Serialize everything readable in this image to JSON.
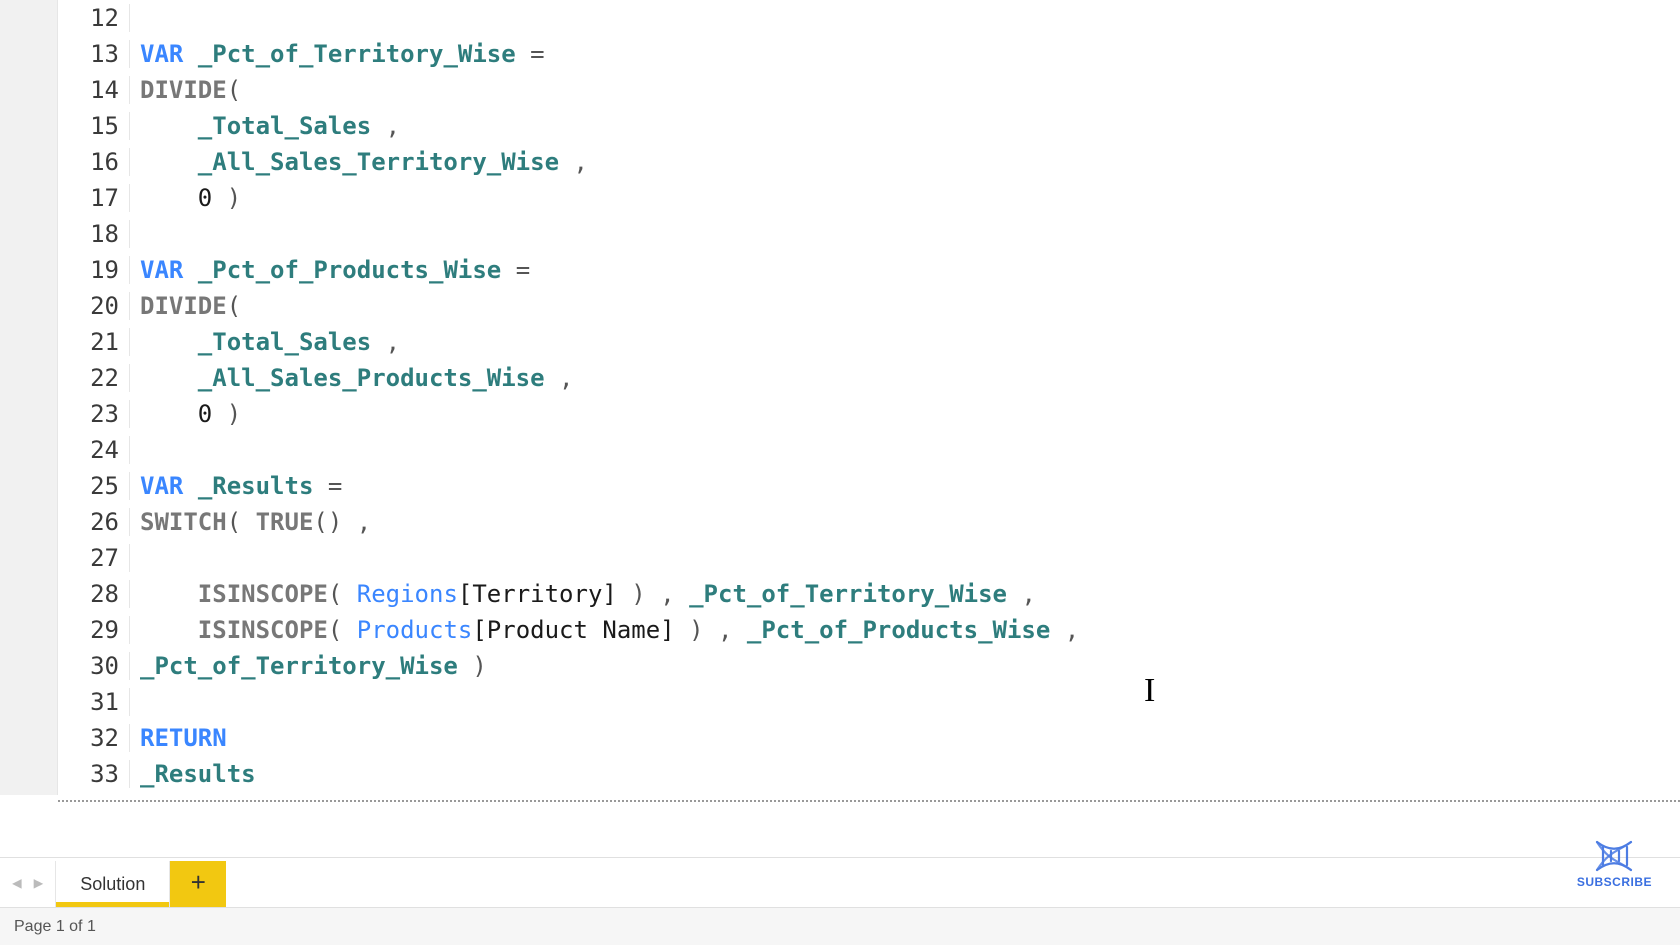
{
  "editor": {
    "lines": [
      {
        "num": 12,
        "tokens": []
      },
      {
        "num": 13,
        "tokens": [
          {
            "c": "t-kw",
            "t": "VAR"
          },
          {
            "t": " "
          },
          {
            "c": "t-var",
            "t": "_Pct_of_Territory_Wise"
          },
          {
            "t": " "
          },
          {
            "c": "t-punc",
            "t": "="
          }
        ]
      },
      {
        "num": 14,
        "tokens": [
          {
            "c": "t-fn",
            "t": "DIVIDE"
          },
          {
            "c": "t-punc",
            "t": "("
          }
        ]
      },
      {
        "num": 15,
        "tokens": [
          {
            "t": "    "
          },
          {
            "c": "t-var",
            "t": "_Total_Sales"
          },
          {
            "t": " "
          },
          {
            "c": "t-punc",
            "t": ","
          }
        ]
      },
      {
        "num": 16,
        "tokens": [
          {
            "t": "    "
          },
          {
            "c": "t-var",
            "t": "_All_Sales_Territory_Wise"
          },
          {
            "t": " "
          },
          {
            "c": "t-punc",
            "t": ","
          }
        ]
      },
      {
        "num": 17,
        "tokens": [
          {
            "t": "    "
          },
          {
            "c": "t-num",
            "t": "0"
          },
          {
            "t": " "
          },
          {
            "c": "t-punc",
            "t": ")"
          }
        ]
      },
      {
        "num": 18,
        "tokens": []
      },
      {
        "num": 19,
        "tokens": [
          {
            "c": "t-kw",
            "t": "VAR"
          },
          {
            "t": " "
          },
          {
            "c": "t-var",
            "t": "_Pct_of_Products_Wise"
          },
          {
            "t": " "
          },
          {
            "c": "t-punc",
            "t": "="
          }
        ]
      },
      {
        "num": 20,
        "tokens": [
          {
            "c": "t-fn",
            "t": "DIVIDE"
          },
          {
            "c": "t-punc",
            "t": "("
          }
        ]
      },
      {
        "num": 21,
        "tokens": [
          {
            "t": "    "
          },
          {
            "c": "t-var",
            "t": "_Total_Sales"
          },
          {
            "t": " "
          },
          {
            "c": "t-punc",
            "t": ","
          }
        ]
      },
      {
        "num": 22,
        "tokens": [
          {
            "t": "    "
          },
          {
            "c": "t-var",
            "t": "_All_Sales_Products_Wise"
          },
          {
            "t": " "
          },
          {
            "c": "t-punc",
            "t": ","
          }
        ]
      },
      {
        "num": 23,
        "tokens": [
          {
            "t": "    "
          },
          {
            "c": "t-num",
            "t": "0"
          },
          {
            "t": " "
          },
          {
            "c": "t-punc",
            "t": ")"
          }
        ]
      },
      {
        "num": 24,
        "tokens": []
      },
      {
        "num": 25,
        "tokens": [
          {
            "c": "t-kw",
            "t": "VAR"
          },
          {
            "t": " "
          },
          {
            "c": "t-var",
            "t": "_Results"
          },
          {
            "t": " "
          },
          {
            "c": "t-punc",
            "t": "="
          }
        ]
      },
      {
        "num": 26,
        "tokens": [
          {
            "c": "t-fn",
            "t": "SWITCH"
          },
          {
            "c": "t-punc",
            "t": "( "
          },
          {
            "c": "t-fn",
            "t": "TRUE"
          },
          {
            "c": "t-punc",
            "t": "() ,"
          }
        ]
      },
      {
        "num": 27,
        "tokens": []
      },
      {
        "num": 28,
        "tokens": [
          {
            "t": "    "
          },
          {
            "c": "t-fn",
            "t": "ISINSCOPE"
          },
          {
            "c": "t-punc",
            "t": "( "
          },
          {
            "c": "t-tbl",
            "t": "Regions"
          },
          {
            "c": "t-col",
            "t": "[Territory]"
          },
          {
            "c": "t-punc",
            "t": " ) , "
          },
          {
            "c": "t-var",
            "t": "_Pct_of_Territory_Wise"
          },
          {
            "c": "t-punc",
            "t": " ,"
          }
        ]
      },
      {
        "num": 29,
        "tokens": [
          {
            "t": "    "
          },
          {
            "c": "t-fn",
            "t": "ISINSCOPE"
          },
          {
            "c": "t-punc",
            "t": "( "
          },
          {
            "c": "t-tbl",
            "t": "Products"
          },
          {
            "c": "t-col",
            "t": "[Product Name]"
          },
          {
            "c": "t-punc",
            "t": " ) , "
          },
          {
            "c": "t-var",
            "t": "_Pct_of_Products_Wise"
          },
          {
            "c": "t-punc",
            "t": " ,"
          }
        ]
      },
      {
        "num": 30,
        "tokens": [
          {
            "c": "t-var",
            "t": "_Pct_of_Territory_Wise"
          },
          {
            "c": "t-punc",
            "t": " )"
          }
        ]
      },
      {
        "num": 31,
        "tokens": []
      },
      {
        "num": 32,
        "tokens": [
          {
            "c": "t-kw",
            "t": "RETURN"
          }
        ]
      },
      {
        "num": 33,
        "tokens": [
          {
            "c": "t-var",
            "t": "_Results"
          }
        ]
      }
    ]
  },
  "tabs": {
    "prev_icon": "◀",
    "next_icon": "▶",
    "active_label": "Solution",
    "add_label": "+"
  },
  "status": {
    "page_text": "Page 1 of 1"
  },
  "watermark": {
    "label": "SUBSCRIBE"
  },
  "colors": {
    "accent_yellow": "#F2C811",
    "keyword_blue": "#3a86ff",
    "variable_teal": "#2e7d7d",
    "subscribe_blue": "#3a6fe0"
  }
}
